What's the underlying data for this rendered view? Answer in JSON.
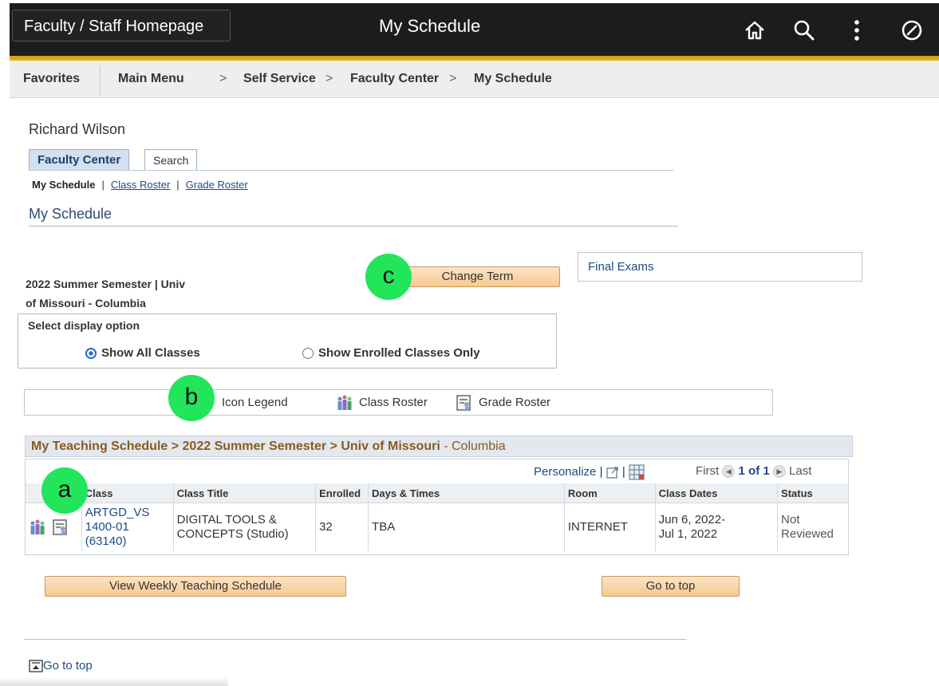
{
  "header": {
    "home_button": "Faculty / Staff Homepage",
    "title": "My Schedule",
    "icons": [
      "home-icon",
      "search-icon",
      "more-vertical-icon",
      "nav-bar-icon"
    ]
  },
  "breadcrumbs": {
    "favorites": "Favorites",
    "main_menu": "Main Menu",
    "sep": ">",
    "items": [
      "Self Service",
      "Faculty Center",
      "My Schedule"
    ]
  },
  "user_name": "Richard Wilson",
  "tabs": [
    {
      "label": "Faculty Center",
      "active": true
    },
    {
      "label": "Search",
      "active": false
    }
  ],
  "subnav": {
    "current": "My Schedule",
    "divider": "|",
    "links": [
      "Class Roster",
      "Grade Roster"
    ]
  },
  "page_heading": "My Schedule",
  "term": {
    "line1": "2022 Summer Semester | Univ",
    "line2": "of Missouri - Columbia",
    "change_label": "Change Term"
  },
  "final_exams": "Final Exams",
  "display_option": {
    "title": "Select display option",
    "options": [
      {
        "label": "Show All Classes",
        "selected": true
      },
      {
        "label": "Show Enrolled Classes Only",
        "selected": false
      }
    ]
  },
  "icon_legend": {
    "title": "Icon Legend",
    "class_roster": "Class Roster",
    "grade_roster": "Grade Roster"
  },
  "markers": {
    "a": "a",
    "b": "b",
    "c": "c"
  },
  "teaching": {
    "heading_parts": [
      "My Teaching Schedule > 2022 Summer Semester > Univ of Missouri",
      " - Columbia"
    ],
    "personalize": "Personalize",
    "sep": "|",
    "nav_first": "First",
    "nav_count": "1 of 1",
    "nav_last": "Last",
    "columns": [
      "Class",
      "Class Title",
      "Enrolled",
      "Days & Times",
      "Room",
      "Class Dates",
      "Status"
    ],
    "rows": [
      {
        "class_lines": [
          "ARTGD_VS",
          "1400-01",
          "(63140)"
        ],
        "title_lines": [
          "DIGITAL TOOLS &",
          "CONCEPTS (Studio)"
        ],
        "enrolled": "32",
        "days_times": "TBA",
        "room": "INTERNET",
        "dates_lines": [
          "Jun 6, 2022-",
          "Jul 1, 2022"
        ],
        "status_lines": [
          "Not",
          "Reviewed"
        ]
      }
    ]
  },
  "buttons": {
    "weekly": "View Weekly Teaching Schedule",
    "go_top": "Go to top"
  },
  "footer_go_top": "Go to top",
  "colors": {
    "accent_gold": "#e6b520",
    "button_peach": "#f6c992",
    "marker_green": "#22e55a",
    "link_blue": "#1d4a87"
  }
}
